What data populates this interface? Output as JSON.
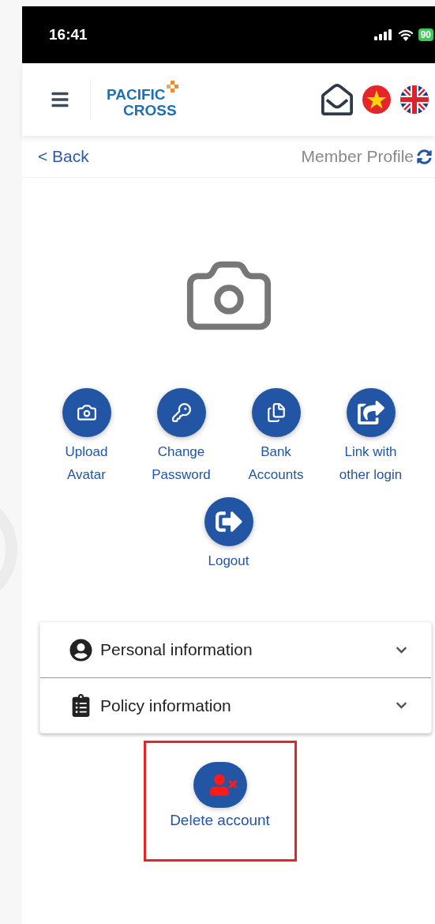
{
  "status_bar": {
    "time": "16:41",
    "battery": "90"
  },
  "header": {
    "logo": [
      "PACIFIC",
      "CROSS"
    ]
  },
  "nav": {
    "back": "< Back",
    "title": "Member Profile"
  },
  "actions": [
    {
      "kind": "camera",
      "label": [
        "Upload",
        "Avatar"
      ]
    },
    {
      "kind": "key",
      "label": [
        "Change",
        "Password"
      ]
    },
    {
      "kind": "files",
      "label": [
        "Bank",
        "Accounts"
      ]
    },
    {
      "kind": "share",
      "label": [
        "Link with",
        "other login"
      ]
    },
    {
      "kind": "logout",
      "label": [
        "Logout"
      ]
    }
  ],
  "sections": [
    {
      "kind": "person",
      "title": "Personal information",
      "expanded": false
    },
    {
      "kind": "clipboard",
      "title": "Policy information",
      "expanded": false
    }
  ],
  "delete_account": {
    "label": "Delete account",
    "highlighted": true
  }
}
